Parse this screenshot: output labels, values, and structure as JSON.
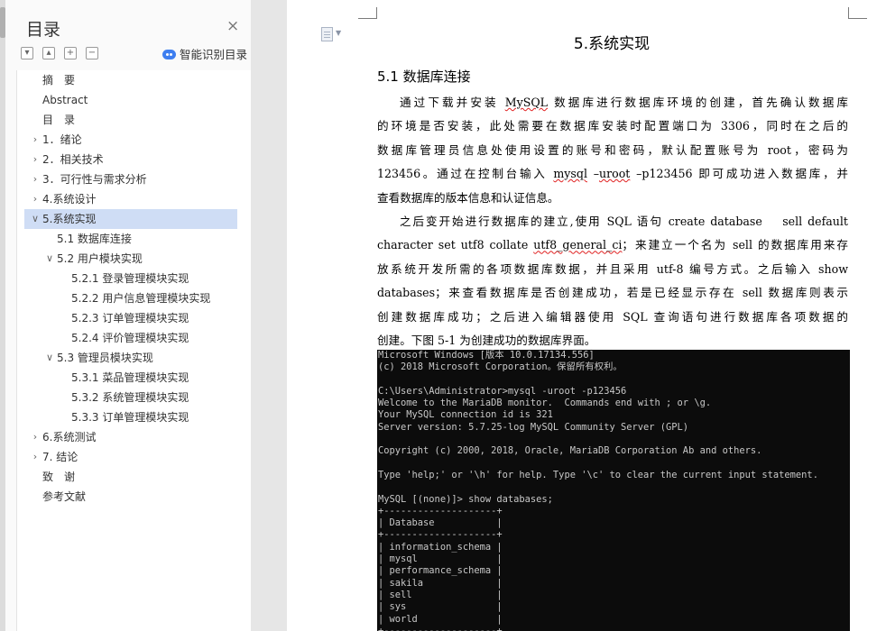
{
  "nav_pane": {
    "title": "目录",
    "close_glyph": "×",
    "controls": [
      {
        "icon": "chevron-down-icon",
        "glyph": "▾"
      },
      {
        "icon": "chevron-up-icon",
        "glyph": "▴"
      },
      {
        "icon": "plus-icon",
        "glyph": "+"
      },
      {
        "icon": "minus-icon",
        "glyph": "−"
      }
    ],
    "smart_toc_label": "智能识别目录",
    "items": [
      {
        "label": "摘　要",
        "expand": ""
      },
      {
        "label": "Abstract",
        "expand": ""
      },
      {
        "label": "目　录",
        "expand": ""
      },
      {
        "label": "1．绪论",
        "expand": "collapsed"
      },
      {
        "label": "2．相关技术",
        "expand": "collapsed"
      },
      {
        "label": "3．可行性与需求分析",
        "expand": "collapsed"
      },
      {
        "label": "4.系统设计",
        "expand": "collapsed"
      },
      {
        "label": "5.系统实现",
        "expand": "expanded",
        "selected": true
      },
      {
        "label": "5.1 数据库连接",
        "expand": ""
      },
      {
        "label": "5.2 用户模块实现",
        "expand": "expanded"
      },
      {
        "label": "5.2.1  登录管理模块实现",
        "expand": ""
      },
      {
        "label": "5.2.2  用户信息管理模块实现",
        "expand": ""
      },
      {
        "label": "5.2.3  订单管理模块实现",
        "expand": ""
      },
      {
        "label": "5.2.4  评价管理模块实现",
        "expand": ""
      },
      {
        "label": "5.3  管理员模块实现",
        "expand": "expanded"
      },
      {
        "label": "5.3.1  菜品管理模块实现",
        "expand": ""
      },
      {
        "label": "5.3.2  系统管理模块实现",
        "expand": ""
      },
      {
        "label": "5.3.3  订单管理模块实现",
        "expand": ""
      },
      {
        "label": "6.系统测试",
        "expand": "collapsed"
      },
      {
        "label": "7. 结论",
        "expand": "collapsed"
      },
      {
        "label": "致　谢",
        "expand": ""
      },
      {
        "label": "参考文献",
        "expand": ""
      }
    ]
  },
  "document": {
    "section_title": "5.系统实现",
    "subsection_title": "5.1 数据库连接",
    "para1": {
      "l1a": "通过下载并安装 ",
      "l1b": "MySQL",
      "l1c": " 数据库进行数据库环境的创建，首先确认数据库",
      "l2": "的环境是否安装，此处需要在数据库安装时配置端口为 3306，同时在之后的",
      "l3": "数据库管理员信息处使用设置的账号和密码，默认配置账号为 root，密码为",
      "l4a": "123456。通过在控制台输入 ",
      "l4b": "mysql",
      "l4c": " –",
      "l4d": "uroot",
      "l4e": " –p123456 即可成功进入数据库，并",
      "l5": "查看数据库的版本信息和认证信息。"
    },
    "para2": {
      "l1": "之后变开始进行数据库的建立,使用 SQL 语句 create database　 sell default",
      "l2a": "character set utf8 collate ",
      "l2b": "utf8_general_ci",
      "l2c": "；来建立一个名为 sell 的数据库用来存",
      "l3": "放系统开发所需的各项数据库数据，并且采用 utf-8 编号方式。之后输入 show",
      "l4": "databases；来查看数据库是否创建成功，若是已经显示存在 sell 数据库则表示",
      "l5": "创建数据库成功；之后进入编辑器使用 SQL 查询语句进行数据库各项数据的",
      "l6": "创建。下图 5-1 为创建成功的数据库界面。"
    },
    "console_lines": [
      "Microsoft Windows [版本 10.0.17134.556]",
      "(c) 2018 Microsoft Corporation。保留所有权利。",
      "",
      "C:\\Users\\Administrator>mysql -uroot -p123456",
      "Welcome to the MariaDB monitor.  Commands end with ; or \\g.",
      "Your MySQL connection id is 321",
      "Server version: 5.7.25-log MySQL Community Server (GPL)",
      "",
      "Copyright (c) 2000, 2018, Oracle, MariaDB Corporation Ab and others.",
      "",
      "Type 'help;' or '\\h' for help. Type '\\c' to clear the current input statement.",
      "",
      "MySQL [(none)]> show databases;",
      "+--------------------+",
      "| Database           |",
      "+--------------------+",
      "| information_schema |",
      "| mysql              |",
      "| performance_schema |",
      "| sakila             |",
      "| sell               |",
      "| sys                |",
      "| world              |",
      "+--------------------+"
    ]
  }
}
